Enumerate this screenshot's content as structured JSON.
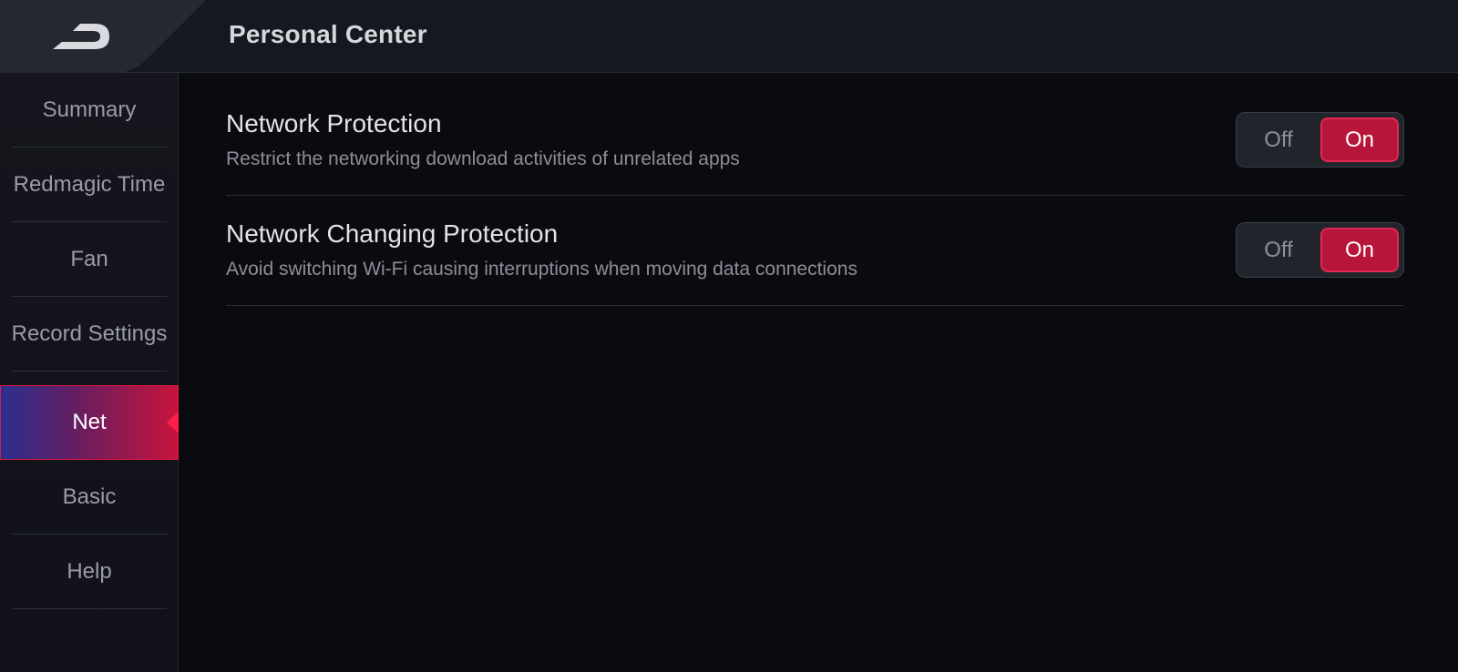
{
  "header": {
    "title": "Personal Center",
    "back_icon": "back-arrow-icon"
  },
  "sidebar": {
    "items": [
      {
        "label": "Summary",
        "active": false
      },
      {
        "label": "Redmagic Time",
        "active": false
      },
      {
        "label": "Fan",
        "active": false
      },
      {
        "label": "Record Settings",
        "active": false
      },
      {
        "label": "Net",
        "active": true
      },
      {
        "label": "Basic",
        "active": false
      },
      {
        "label": "Help",
        "active": false
      }
    ]
  },
  "settings": [
    {
      "title": "Network Protection",
      "description": "Restrict the networking download activities of unrelated apps",
      "toggle": {
        "off_label": "Off",
        "on_label": "On",
        "value": "On"
      }
    },
    {
      "title": "Network Changing Protection",
      "description": "Avoid switching Wi-Fi causing interruptions when moving data connections",
      "toggle": {
        "off_label": "Off",
        "on_label": "On",
        "value": "On"
      }
    }
  ],
  "colors": {
    "background": "#0a0b11",
    "header": "#16181f",
    "accent": "#b8153b",
    "active_gradient_start": "#2a2f8e",
    "active_gradient_end": "#c8143c"
  }
}
